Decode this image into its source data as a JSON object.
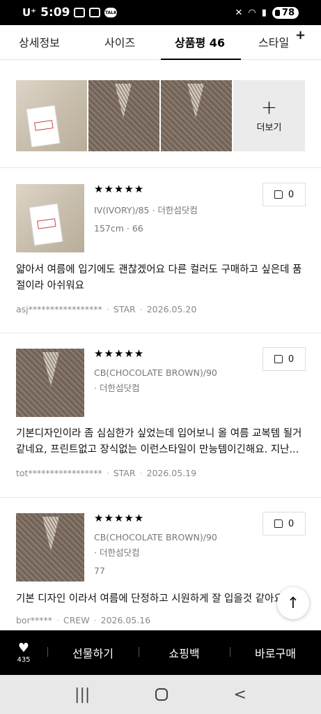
{
  "status_bar": {
    "carrier": "U⁺",
    "time": "5:09",
    "battery": "78"
  },
  "tabs": [
    {
      "label": "상세정보"
    },
    {
      "label": "사이즈"
    },
    {
      "label": "상품평 46"
    },
    {
      "label": "스타일"
    }
  ],
  "photo_strip": {
    "more_label": "더보기"
  },
  "reviews": [
    {
      "stars": "★★★★★",
      "option": "IV(IVORY)/85 · 더한섬닷컴",
      "body_info": "157cm · 66",
      "likes": "0",
      "text": "얇아서 여름에 입기에도 괜찮겠어요 다른 컬러도 구매하고 싶은데 품절이라 아쉬워요",
      "user": "asj*****************",
      "grade": "STAR",
      "date": "2026.05.20"
    },
    {
      "stars": "★★★★★",
      "option": "CB(CHOCOLATE BROWN)/90",
      "option2": "· 더한섬닷컴",
      "likes": "0",
      "text": "기본디자인이라 좀 심심한가 싶었는데 입어보니 올 여름 교복템 될거 같네요,  프린트없고 장식없는 이런스타일이 만능템이긴해요. 지난...",
      "user": "tot*****************",
      "grade": "STAR",
      "date": "2026.05.19"
    },
    {
      "stars": "★★★★★",
      "option": "CB(CHOCOLATE BROWN)/90",
      "option2": "· 더한섬닷컴",
      "body_info": "77",
      "likes": "0",
      "text": "기본 디자인 이라서 여름에 단정하고 시원하게 잘 입을것 같아요",
      "user": "bor*****",
      "grade": "CREW",
      "date": "2026.05.16"
    }
  ],
  "action_bar": {
    "like_count": "435",
    "gift": "선물하기",
    "bag": "쇼핑백",
    "buy": "바로구매"
  },
  "nav_bar": {
    "recent": "|||",
    "back": "<"
  }
}
